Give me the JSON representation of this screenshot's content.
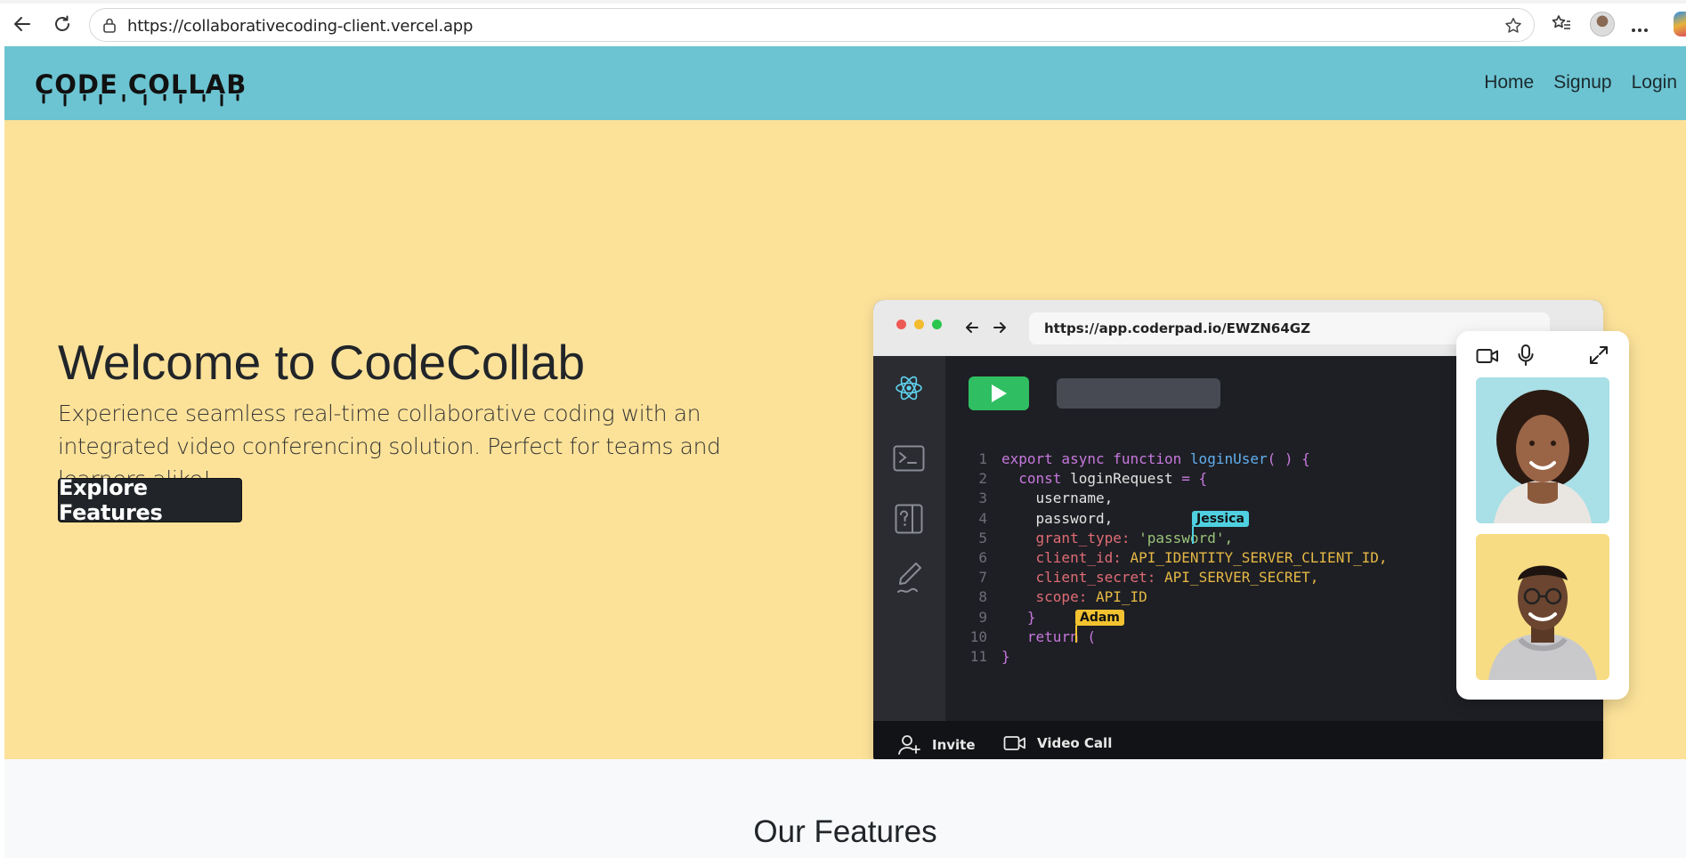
{
  "browser": {
    "url": "https://collaborativecoding-client.vercel.app"
  },
  "site": {
    "logo": "CODE COLLAB",
    "nav": {
      "home": "Home",
      "signup": "Signup",
      "login": "Login"
    }
  },
  "hero": {
    "title": "Welcome to CodeCollab",
    "subtitle": "Experience seamless real-time collaborative coding with an integrated video conferencing solution. Perfect for teams and learners alike!",
    "cta": "Explore Features"
  },
  "mockup": {
    "url": "https://app.coderpad.io/EWZN64GZ",
    "line_numbers": [
      "1",
      "2",
      "3",
      "4",
      "5",
      "6",
      "7",
      "8",
      "9",
      "10",
      "11"
    ],
    "code": {
      "l1_kw": "export async function ",
      "l1_fn": "loginUser",
      "l1_rest": "( ) {",
      "l2_kw": "const ",
      "l2_name": "loginRequest",
      "l2_rest": " = {",
      "l3": "username,",
      "l4": "password,",
      "l5_prop": "grant_type: ",
      "l5_str": "'password',",
      "l6_prop": "client_id: ",
      "l6_val": "API_IDENTITY_SERVER_CLIENT_ID,",
      "l7_prop": "client_secret: ",
      "l7_val": "API_SERVER_SECRET,",
      "l8_prop": "scope: ",
      "l8_val": "API_ID",
      "l9": "}",
      "l10_kw": "return (",
      "l11": "}"
    },
    "cursors": {
      "jessica": "Jessica",
      "adam": "Adam"
    },
    "bottom": {
      "invite": "Invite",
      "video_call": "Video Call"
    },
    "colors": {
      "jessica": "#4fd0e0",
      "adam": "#f2c230",
      "run": "#2fbf62"
    }
  },
  "features": {
    "heading": "Our Features"
  }
}
